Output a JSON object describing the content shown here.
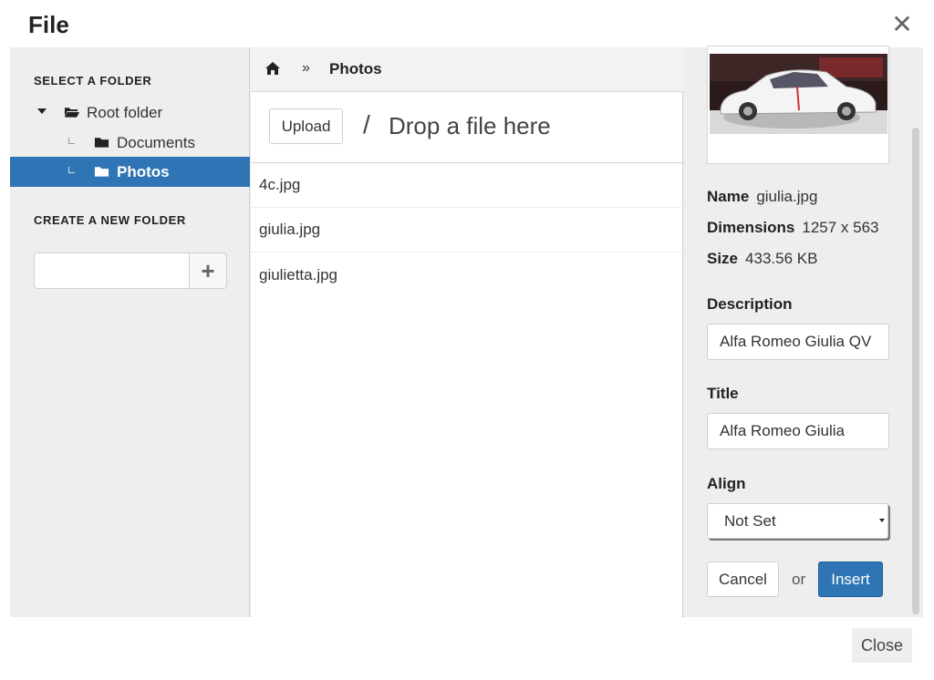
{
  "dialog": {
    "title": "File",
    "close_icon": "close-icon",
    "footer_close_label": "Close"
  },
  "left": {
    "select_folder_label": "SELECT A FOLDER",
    "create_folder_label": "CREATE A NEW FOLDER",
    "new_folder_value": "",
    "add_folder_icon": "plus-icon",
    "tree": [
      {
        "label": "Root folder",
        "icon": "folder-open-icon",
        "expanded": true,
        "selected": false
      },
      {
        "label": "Documents",
        "icon": "folder-icon",
        "selected": false
      },
      {
        "label": "Photos",
        "icon": "folder-icon",
        "selected": true
      }
    ]
  },
  "center": {
    "breadcrumb": {
      "home_icon": "home-icon",
      "separator": "»",
      "current": "Photos"
    },
    "upload_label": "Upload",
    "upload_separator": "/",
    "drop_placeholder": "Drop a file here",
    "files": [
      "4c.jpg",
      "giulia.jpg",
      "giulietta.jpg"
    ]
  },
  "right": {
    "preview_alt": "giulia.jpg",
    "name_key": "Name",
    "name_value": "giulia.jpg",
    "dimensions_key": "Dimensions",
    "dimensions_value": "1257 x 563",
    "size_key": "Size",
    "size_value": "433.56 KB",
    "description_label": "Description",
    "description_value": "Alfa Romeo Giulia QV",
    "title_label": "Title",
    "title_value": "Alfa Romeo Giulia",
    "align_label": "Align",
    "align_value": "Not Set",
    "cancel_label": "Cancel",
    "or_label": "or",
    "insert_label": "Insert"
  },
  "colors": {
    "accent": "#2f75b5",
    "panel_bg": "#eeeeee"
  }
}
